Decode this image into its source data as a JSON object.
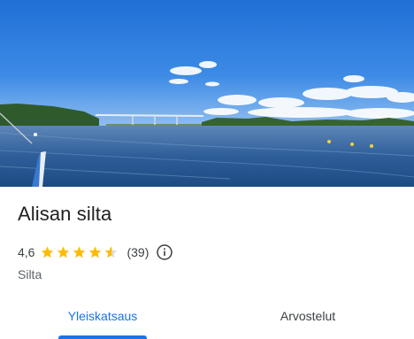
{
  "place": {
    "name": "Alisan silta",
    "rating_text": "4,6",
    "rating_value": 4.6,
    "review_count_text": "(39)",
    "category": "Silta"
  },
  "tabs": [
    {
      "label": "Yleiskatsaus",
      "active": true
    },
    {
      "label": "Arvostelut",
      "active": false
    }
  ],
  "colors": {
    "accent": "#1a73e8",
    "star": "#fbbc04",
    "text_primary": "#202124",
    "text_secondary": "#5f6368"
  },
  "icons": {
    "star": "star-icon",
    "info": "info-icon"
  }
}
